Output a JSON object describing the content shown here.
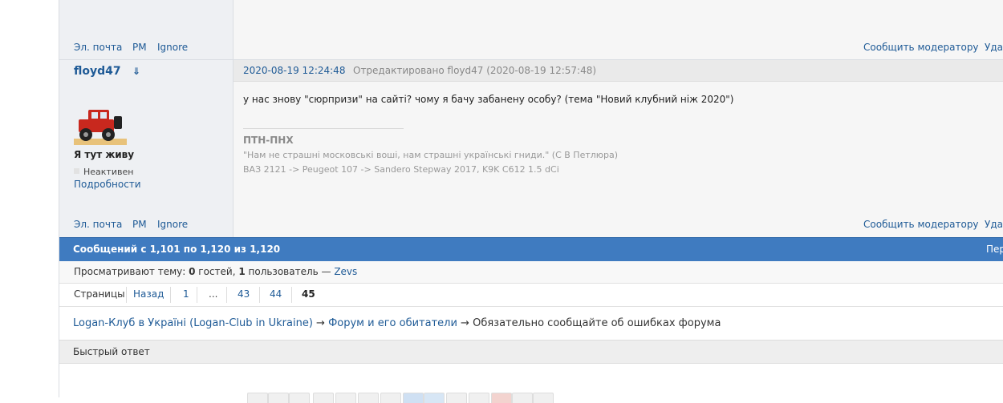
{
  "prev_post": {
    "actions": {
      "email": "Эл. почта",
      "pm": "PM",
      "ignore": "Ignore"
    },
    "report": "Сообщить модератору",
    "delete_partial": "Уда"
  },
  "post": {
    "username": "floyd47",
    "arrow": "⇓",
    "user_title": "Я тут живу",
    "status": "Неактивен",
    "details": "Подробности",
    "date": "2020-08-19 12:24:48",
    "edited": "Отредактировано floyd47 (2020-08-19 12:57:48)",
    "message": "у нас знову \"сюрпризи\" на сайті? чому я бачу забанену особу? (тема \"Новий клубний ніж 2020\")",
    "signature": {
      "title": "ПТН-ПНХ",
      "quote": "\"Нам не страшні московські воші, нам страшні українські гниди.\" (С В Петлюра)",
      "cars": "ВАЗ 2121 -> Peugeot 107 -> Sandero Stepway 2017, K9K C612 1.5 dCi"
    },
    "actions": {
      "email": "Эл. почта",
      "pm": "PM",
      "ignore": "Ignore"
    },
    "report": "Сообщить модератору",
    "delete_partial": "Уда"
  },
  "summary_bar": {
    "text": "Сообщений с 1,101 по 1,120 из 1,120",
    "right_partial": "Пер"
  },
  "viewers": {
    "prefix": "Просматривают тему: ",
    "guests_count": "0",
    "guests_label": " гостей, ",
    "users_count": "1",
    "users_label": " пользователь — ",
    "user": "Zevs"
  },
  "pagination": {
    "label": "Страницы",
    "back": "Назад",
    "pages": [
      "1",
      "...",
      "43",
      "44"
    ],
    "current": "45"
  },
  "breadcrumb": {
    "site": "Logan-Клуб в Україні (Logan-Club in Ukraine)",
    "sep": "→",
    "forum": "Форум и его обитатели",
    "topic": "Обязательно сообщайте об ошибках форума"
  },
  "quick_reply": {
    "title": "Быстрый ответ"
  },
  "colors": {
    "accent": "#1e5a96",
    "bar": "#3f7bc0",
    "avatar_car": "#c8281e"
  }
}
